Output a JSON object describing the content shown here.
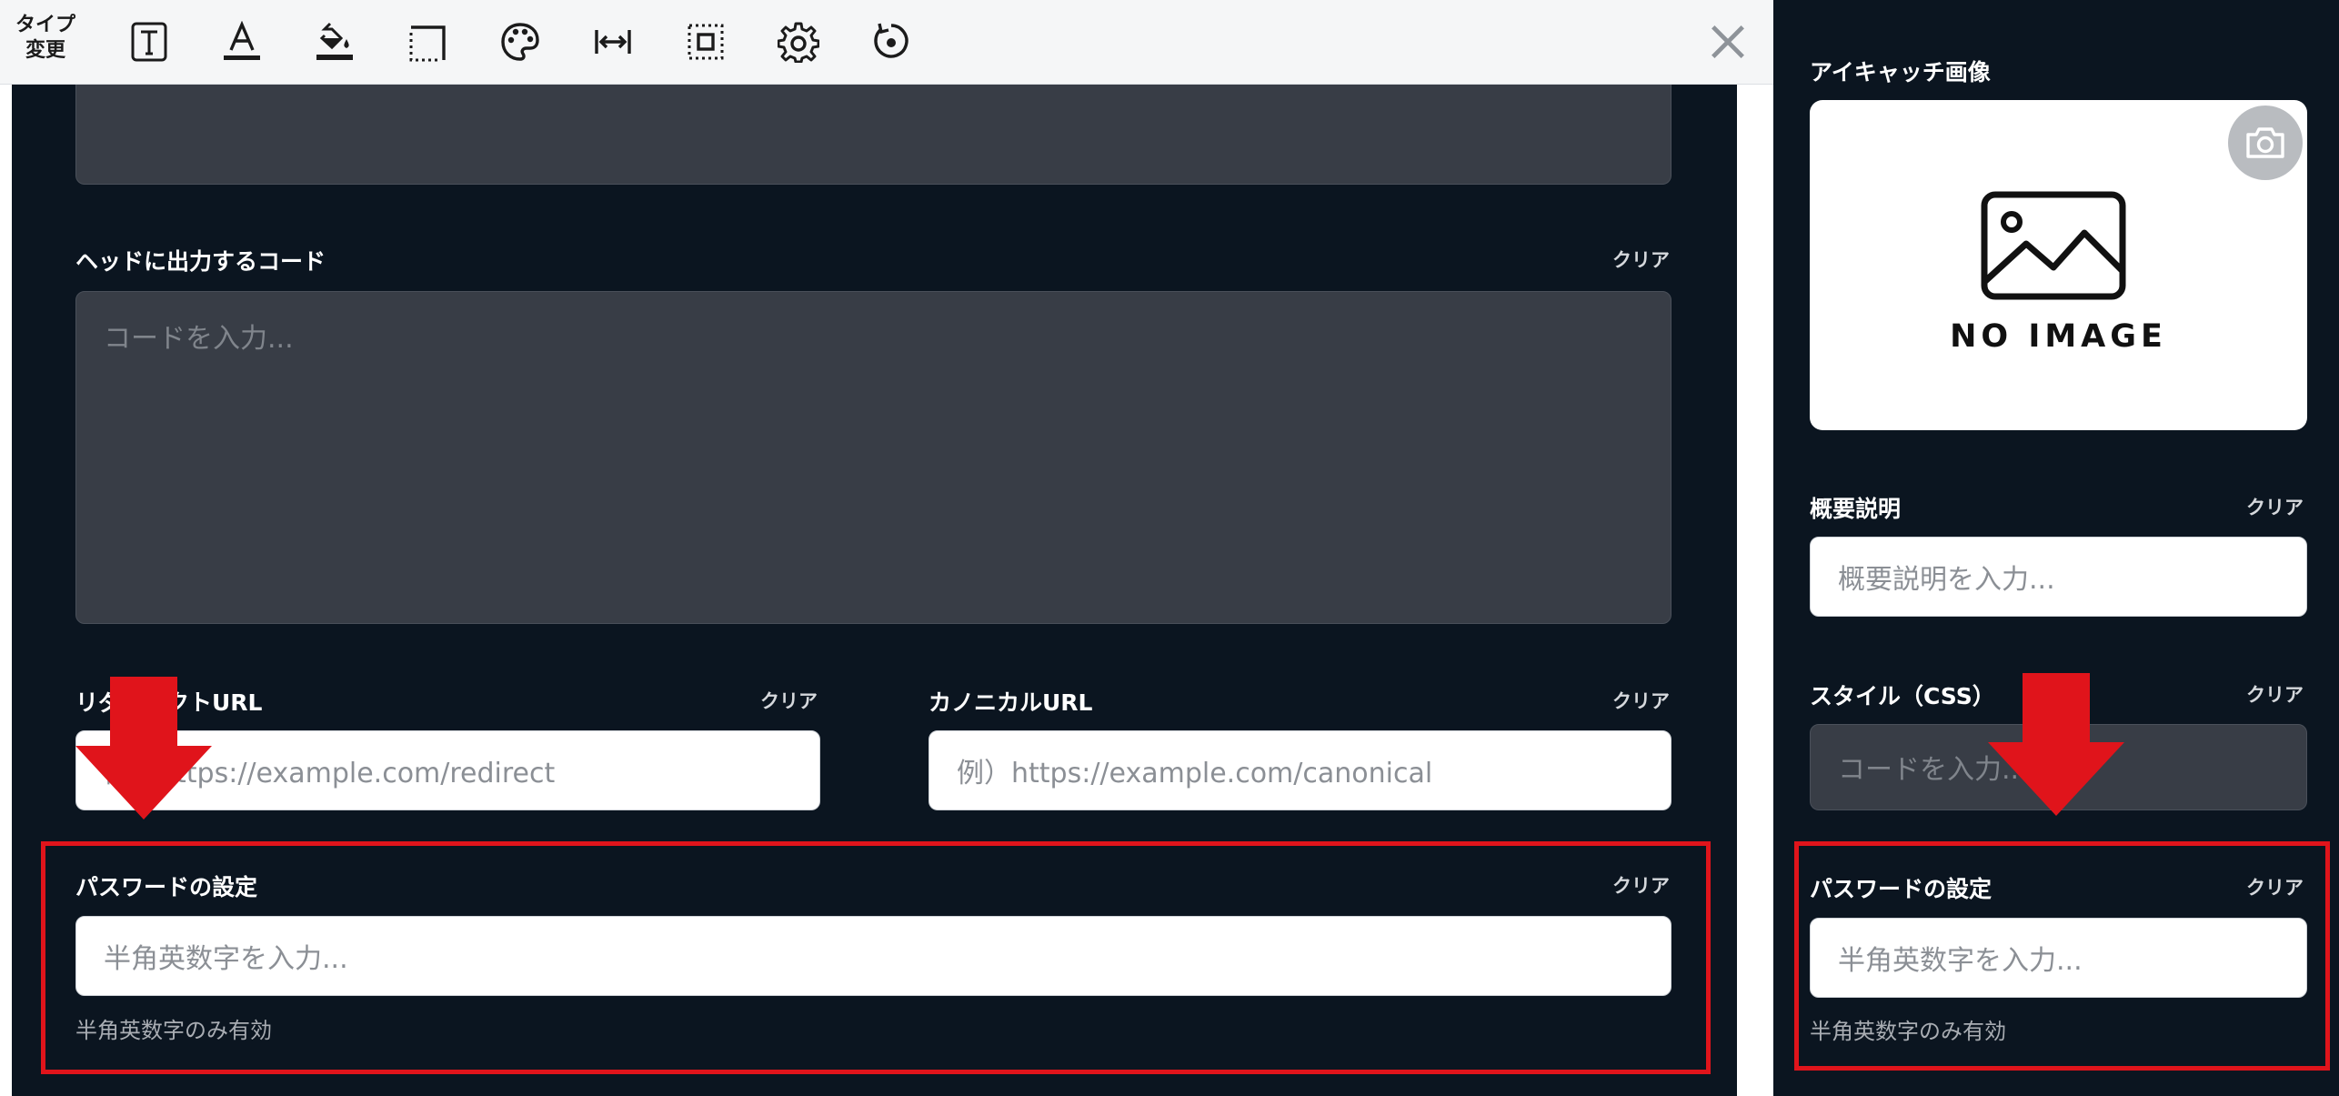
{
  "toolbar": {
    "type_change_line1": "タイプ",
    "type_change_line2": "変更",
    "icons": [
      "text-box-icon",
      "font-color-icon",
      "fill-color-icon",
      "border-icon",
      "palette-icon",
      "width-icon",
      "padding-icon",
      "gear-icon",
      "reset-icon"
    ],
    "close_icon": "close-icon"
  },
  "left": {
    "head_code": {
      "label": "ヘッドに出力するコード",
      "clear": "クリア",
      "placeholder": "コードを入力..."
    },
    "redirect": {
      "label": "リダイレクトURL",
      "clear": "クリア",
      "placeholder": "例）https://example.com/redirect"
    },
    "canonical": {
      "label": "カノニカルURL",
      "clear": "クリア",
      "placeholder": "例）https://example.com/canonical"
    },
    "password": {
      "label": "パスワードの設定",
      "clear": "クリア",
      "placeholder": "半角英数字を入力...",
      "hint": "半角英数字のみ有効"
    }
  },
  "right": {
    "eyecatch": {
      "label": "アイキャッチ画像",
      "no_image": "NO IMAGE"
    },
    "summary": {
      "label": "概要説明",
      "clear": "クリア",
      "placeholder": "概要説明を入力..."
    },
    "style": {
      "label": "スタイル（CSS）",
      "clear": "クリア",
      "placeholder": "コードを入力..."
    },
    "password": {
      "label": "パスワードの設定",
      "clear": "クリア",
      "placeholder": "半角英数字を入力...",
      "hint": "半角英数字のみ有効"
    }
  },
  "colors": {
    "background": "#0b1520",
    "highlight": "#e0141b",
    "input_dark": "#383d46"
  }
}
